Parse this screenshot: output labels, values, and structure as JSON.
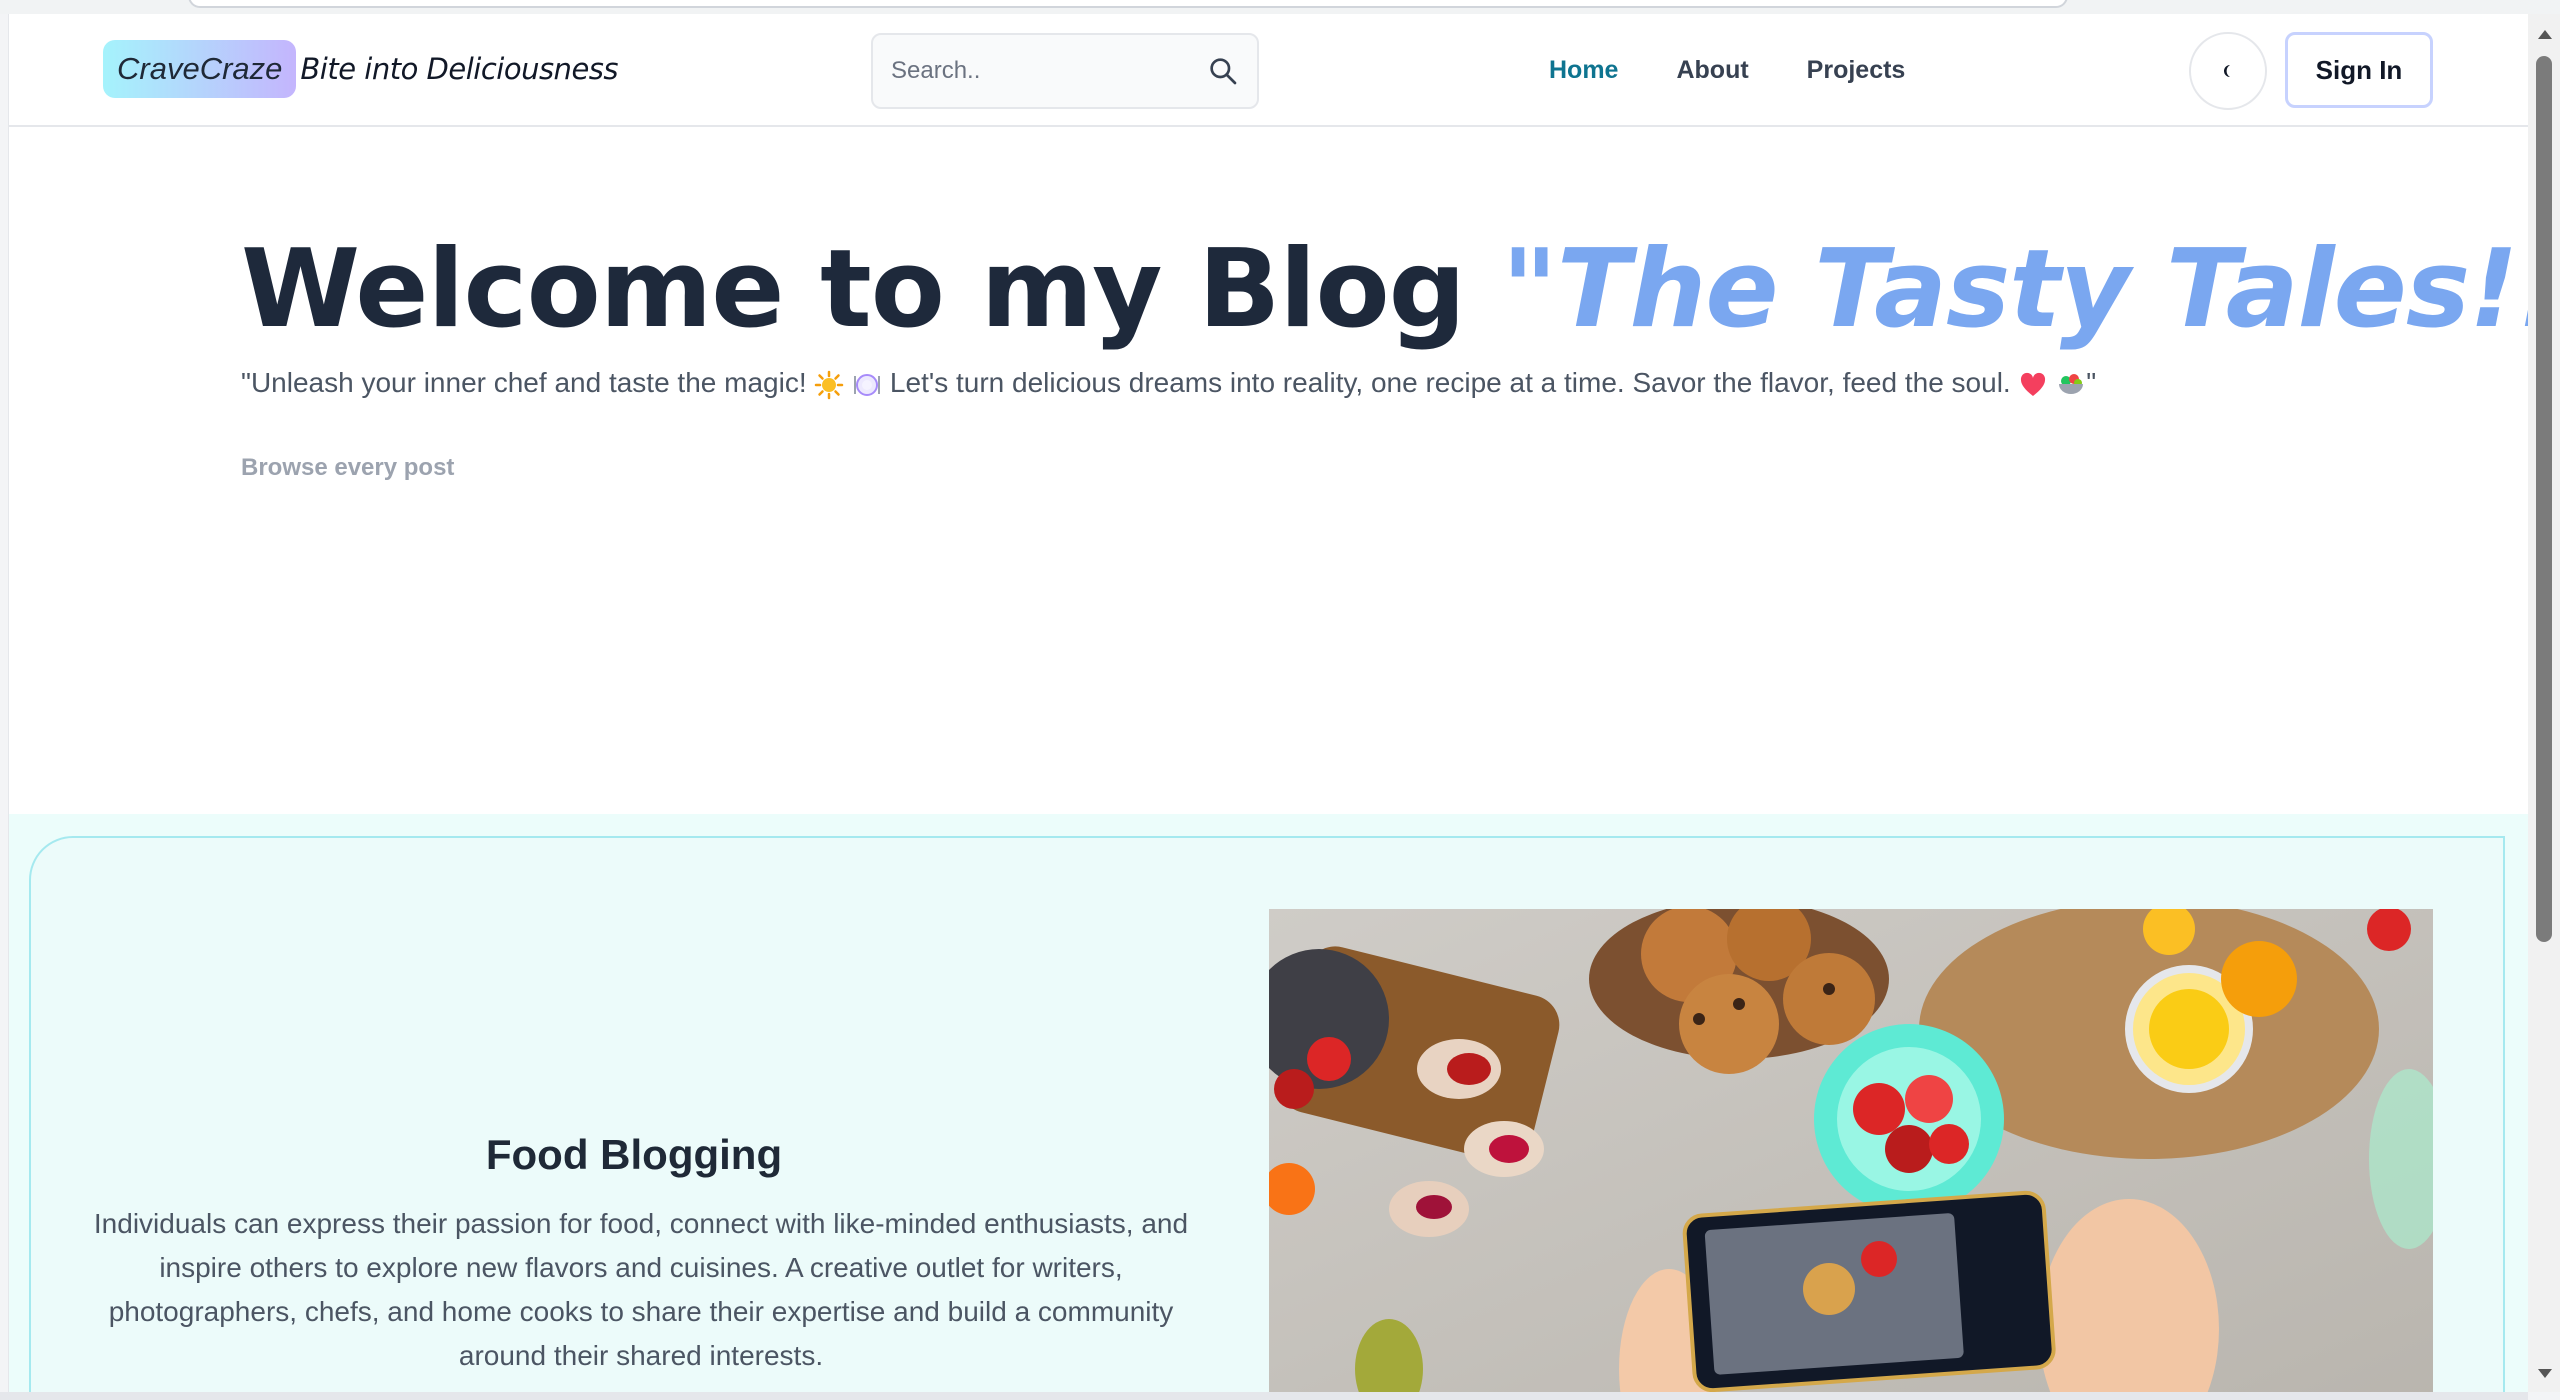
{
  "navbar": {
    "brand_name": "CraveCraze",
    "brand_tagline": "Bite into Deliciousness",
    "search_placeholder": "Search..",
    "links": [
      {
        "label": "Home",
        "active": true
      },
      {
        "label": "About",
        "active": false
      },
      {
        "label": "Projects",
        "active": false
      }
    ],
    "signin_label": "Sign In",
    "theme_icon": "moon-icon"
  },
  "hero": {
    "title_main": "Welcome to my Blog ",
    "title_accent": "\"The Tasty Tales!!\"",
    "subtitle_part1": "\"Unleash your inner chef and taste the magic! ",
    "subtitle_part2": " Let's turn delicious dreams into reality, one recipe at a time. Savor the flavor, feed the soul. ",
    "subtitle_part3": "\"",
    "browse_link": "Browse every post"
  },
  "feature": {
    "title": "Food Blogging",
    "text": "Individuals can express their passion for food, connect with like-minded enthusiasts, and inspire others to explore new flavors and cuisines. A creative outlet for writers, photographers, chefs, and home cooks to share their expertise and build a community around their shared interests.",
    "image_alt": "food-photography-image"
  },
  "colors": {
    "accent": "#7aa7f0",
    "active_link": "#0e7490",
    "brand_gradient_start": "#a5f3fc",
    "brand_gradient_end": "#c4b5fd",
    "feature_bg": "#ecfdfb"
  }
}
